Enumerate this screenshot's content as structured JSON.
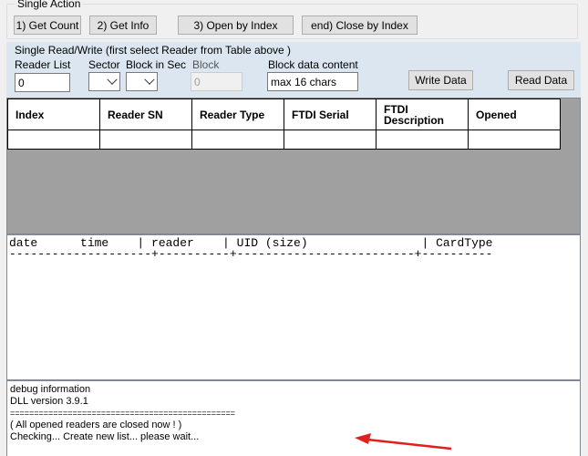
{
  "single_action": {
    "legend": "Single Action",
    "buttons": [
      "1) Get Count",
      "2) Get Info",
      "3) Open by Index",
      "end) Close by Index"
    ]
  },
  "read_write": {
    "legend": "Single Read/Write  (first select Reader from Table above )",
    "reader_list_label": "Reader List",
    "reader_list_value": "0",
    "sector_label": "Sector",
    "block_in_sec_label": "Block in Sec",
    "block_label": "Block",
    "block_value": "0",
    "block_data_label": "Block data content",
    "block_data_value": "max 16 chars",
    "write_button": "Write Data",
    "read_button": "Read Data"
  },
  "reader_table": {
    "columns": [
      "Index",
      "Reader SN",
      "Reader Type",
      "FTDI Serial",
      "FTDI Description",
      "Opened"
    ]
  },
  "card_log": {
    "header": "date      time    | reader    | UID (size)                | CardType",
    "separator": "--------------------+----------+-------------------------+----------"
  },
  "debug": {
    "lines": [
      "debug information",
      "DLL version 3.9.1",
      "===============================================",
      "( All opened readers are closed now ! )",
      "Checking... Create new list... please wait..."
    ]
  },
  "colors": {
    "annotation_arrow": "#e02020",
    "button_bg": "#e1e1e1",
    "panel_bg": "#f0f0f0"
  }
}
